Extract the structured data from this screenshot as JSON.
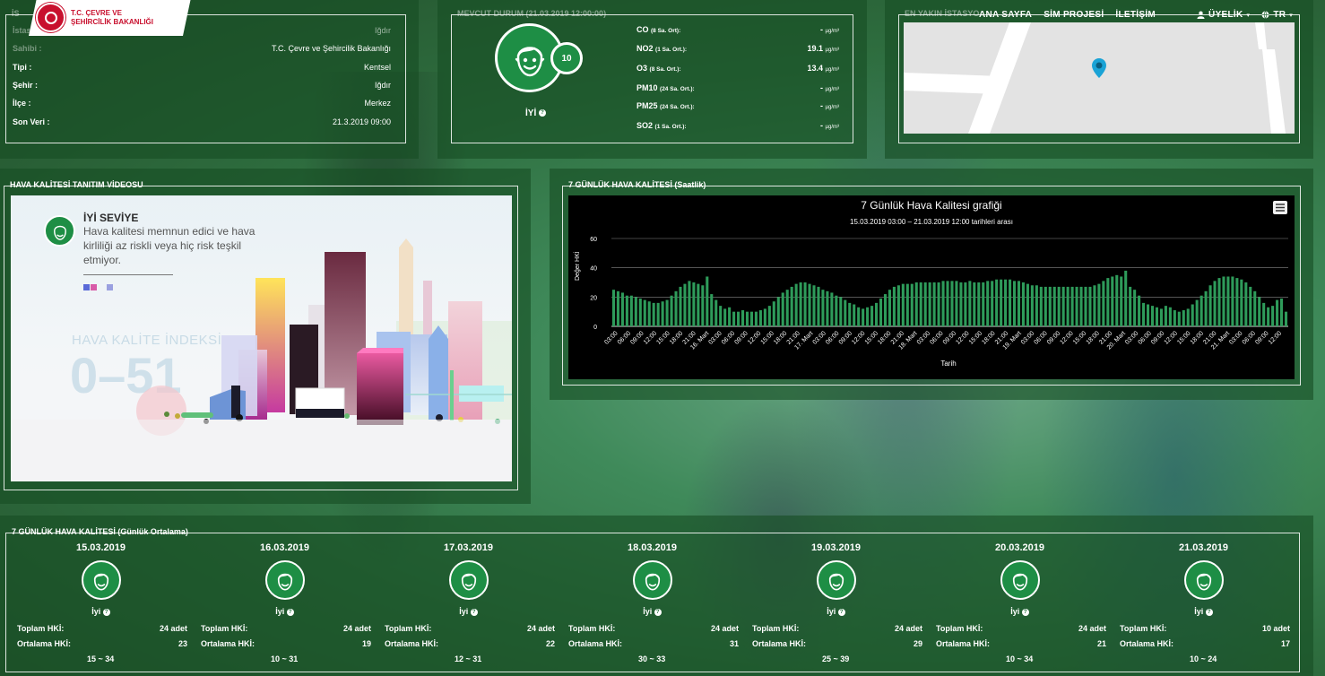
{
  "brand": {
    "line1": "T.C. ÇEVRE VE",
    "line2": "ŞEHİRCİLİK BAKANLIĞI"
  },
  "nav": {
    "home": "ANA SAYFA",
    "sim": "SİM PROJESİ",
    "contact": "İLETİŞİM",
    "member": "ÜYELİK",
    "lang": "TR"
  },
  "station": {
    "legend": "İS",
    "name_label": "İstasyon Adı :",
    "name": "Iğdır",
    "owner_label": "Sahibi :",
    "owner": "T.C. Çevre ve Şehircilik Bakanlığı",
    "rows": [
      {
        "label": "Tipi :",
        "value": "Kentsel"
      },
      {
        "label": "Şehir :",
        "value": "Iğdır"
      },
      {
        "label": "İlçe :",
        "value": "Merkez"
      },
      {
        "label": "Son Veri :",
        "value": "21.3.2019 09:00"
      }
    ]
  },
  "current": {
    "legend": "MEVCUT DURUM (21.03.2019 12:00:00)",
    "index": "10",
    "status": "İYİ",
    "pollutants": [
      {
        "name": "CO",
        "period": "(8 Sa. Ort):",
        "value": "-",
        "unit": "µg/m³"
      },
      {
        "name": "NO2",
        "period": "(1 Sa. Ort.):",
        "value": "19.1",
        "unit": "µg/m³"
      },
      {
        "name": "O3",
        "period": "(8 Sa. Ort.):",
        "value": "13.4",
        "unit": "µg/m³"
      },
      {
        "name": "PM10",
        "period": "(24 Sa. Ort.):",
        "value": "-",
        "unit": "µg/m³"
      },
      {
        "name": "PM25",
        "period": "(24 Sa. Ort.):",
        "value": "-",
        "unit": "µg/m³"
      },
      {
        "name": "SO2",
        "period": "(1 Sa. Ort.):",
        "value": "-",
        "unit": "µg/m³"
      }
    ]
  },
  "nearest": {
    "legend": "EN YAKIN İSTASYO"
  },
  "video": {
    "legend": "HAVA KALİTESİ TANITIM VİDEOSU",
    "level_title": "İYİ SEVİYE",
    "level_text": "Hava kalitesi memnun edici ve hava kirliliği az riskli veya hiç risk teşkil etmiyor.",
    "index_title": "HAVA KALİTE İNDEKSİ",
    "index_range": "0–51"
  },
  "chart_section": {
    "legend": "7 GÜNLÜK HAVA KALİTESİ (Saatlik)"
  },
  "chart_data": {
    "type": "bar",
    "title": "7 Günlük Hava Kalitesi grafiği",
    "subtitle": "15.03.2019 03:00 – 21.03.2019 12:00 tarihleri arası",
    "xlabel": "Tarih",
    "ylabel": "Değer HKİ",
    "ylim": [
      0,
      60
    ],
    "yticks": [
      0,
      20,
      40,
      60
    ],
    "color": "#2e9b5a",
    "x_tick_labels": [
      "03:00",
      "06:00",
      "09:00",
      "12:00",
      "15:00",
      "18:00",
      "21:00",
      "16. Mart",
      "03:00",
      "06:00",
      "09:00",
      "12:00",
      "15:00",
      "18:00",
      "21:00",
      "17. Mart",
      "03:00",
      "06:00",
      "09:00",
      "12:00",
      "15:00",
      "18:00",
      "21:00",
      "18. Mart",
      "03:00",
      "06:00",
      "09:00",
      "12:00",
      "15:00",
      "18:00",
      "21:00",
      "19. Mart",
      "03:00",
      "06:00",
      "09:00",
      "12:00",
      "15:00",
      "18:00",
      "21:00",
      "20. Mart",
      "03:00",
      "06:00",
      "09:00",
      "12:00",
      "15:00",
      "18:00",
      "21:00",
      "21. Mart",
      "03:00",
      "06:00",
      "09:00",
      "12:00"
    ],
    "values": [
      25,
      24,
      23,
      21,
      21,
      20,
      19,
      18,
      17,
      16,
      16,
      17,
      18,
      21,
      24,
      27,
      29,
      31,
      30,
      29,
      28,
      34,
      22,
      18,
      14,
      12,
      13,
      10,
      10,
      11,
      10,
      10,
      10,
      11,
      12,
      14,
      17,
      20,
      23,
      25,
      27,
      29,
      30,
      30,
      29,
      28,
      27,
      25,
      24,
      23,
      21,
      20,
      18,
      16,
      15,
      13,
      12,
      13,
      14,
      16,
      19,
      22,
      25,
      27,
      28,
      29,
      29,
      29,
      30,
      30,
      30,
      30,
      30,
      30,
      31,
      31,
      31,
      31,
      30,
      30,
      31,
      30,
      30,
      30,
      31,
      31,
      32,
      32,
      32,
      32,
      31,
      31,
      30,
      29,
      28,
      28,
      27,
      27,
      27,
      27,
      27,
      27,
      27,
      27,
      27,
      27,
      27,
      27,
      28,
      29,
      31,
      33,
      34,
      35,
      34,
      38,
      27,
      25,
      21,
      16,
      15,
      14,
      13,
      12,
      14,
      13,
      11,
      10,
      11,
      12,
      15,
      18,
      21,
      24,
      28,
      31,
      33,
      34,
      34,
      34,
      33,
      32,
      30,
      27,
      24,
      20,
      16,
      13,
      14,
      18,
      19,
      10
    ]
  },
  "daily": {
    "legend": "7 GÜNLÜK HAVA KALİTESİ (Günlük Ortalama)",
    "total_label": "Toplam HKİ:",
    "avg_label": "Ortalama HKİ:",
    "days": [
      {
        "date": "15.03.2019",
        "status": "İyi",
        "total": "24 adet",
        "avg": "23",
        "range": "15 ~ 34"
      },
      {
        "date": "16.03.2019",
        "status": "İyi",
        "total": "24 adet",
        "avg": "19",
        "range": "10 ~ 31"
      },
      {
        "date": "17.03.2019",
        "status": "İyi",
        "total": "24 adet",
        "avg": "22",
        "range": "12 ~ 31"
      },
      {
        "date": "18.03.2019",
        "status": "İyi",
        "total": "24 adet",
        "avg": "31",
        "range": "30 ~ 33"
      },
      {
        "date": "19.03.2019",
        "status": "İyi",
        "total": "24 adet",
        "avg": "29",
        "range": "25 ~ 39"
      },
      {
        "date": "20.03.2019",
        "status": "İyi",
        "total": "24 adet",
        "avg": "21",
        "range": "10 ~ 34"
      },
      {
        "date": "21.03.2019",
        "status": "İyi",
        "total": "10 adet",
        "avg": "17",
        "range": "10 ~ 24"
      }
    ]
  },
  "icons": [
    "face-good-icon",
    "user-icon",
    "globe-icon",
    "question-icon",
    "map-pin-icon",
    "chart-menu-icon"
  ],
  "colors": {
    "good": "#1e8e45",
    "brand_red": "#c8102e",
    "chart_bar": "#2e9b5a"
  }
}
